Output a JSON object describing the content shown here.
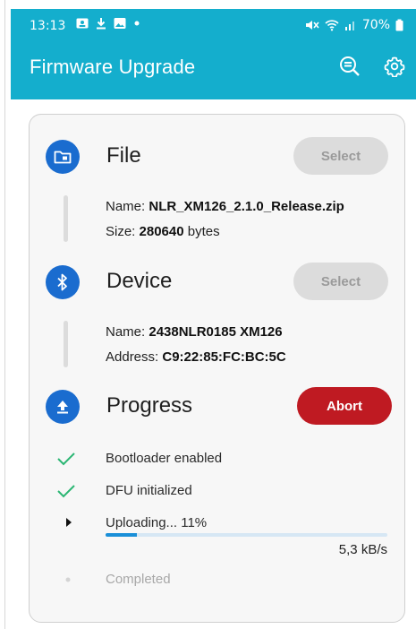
{
  "status_bar": {
    "time": "13:13",
    "battery": "70%"
  },
  "app_bar": {
    "title": "Firmware Upgrade"
  },
  "file": {
    "title": "File",
    "button": "Select",
    "name_label": "Name: ",
    "name": "NLR_XM126_2.1.0_Release.zip",
    "size_label": "Size: ",
    "size": "280640",
    "size_unit": " bytes"
  },
  "device": {
    "title": "Device",
    "button": "Select",
    "name_label": "Name: ",
    "name": "2438NLR0185 XM126",
    "address_label": "Address: ",
    "address": "C9:22:85:FC:BC:5C"
  },
  "progress": {
    "title": "Progress",
    "button": "Abort",
    "steps": [
      {
        "label": "Bootloader enabled",
        "state": "done"
      },
      {
        "label": "DFU initialized",
        "state": "done"
      },
      {
        "label": "Uploading... 11%",
        "state": "active"
      },
      {
        "label": "Completed",
        "state": "pending"
      }
    ],
    "upload_fraction": 0.11,
    "speed": "5,3 kB/s"
  },
  "colors": {
    "app_bar": "#14aecd",
    "step_icon": "#1a6ccf",
    "abort": "#bf1a22",
    "check": "#2bb673",
    "progress_fill": "#1a8fd8"
  }
}
